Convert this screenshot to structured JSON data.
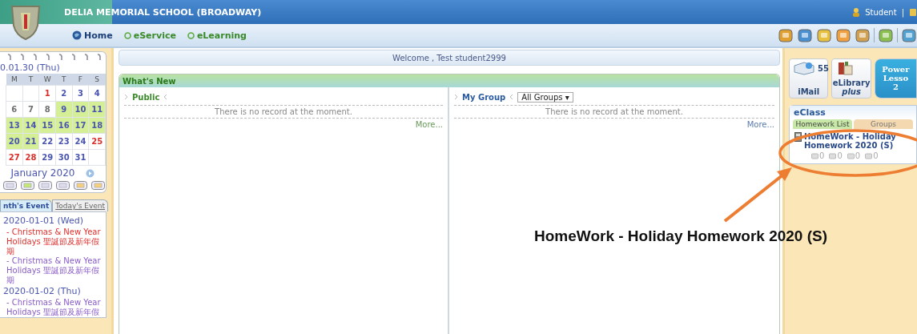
{
  "header": {
    "school_name": "DELIA MEMORIAL SCHOOL (BROADWAY)",
    "user_label": "Student",
    "separator": "|"
  },
  "nav": [
    {
      "label": "Home",
      "selected": true
    },
    {
      "label": "eService",
      "selected": false
    },
    {
      "label": "eLearning",
      "selected": false
    }
  ],
  "welcome": "Welcome , Test student2999",
  "calendar": {
    "date_heading": "0.01.30 (Thu)",
    "weekdays": [
      "M",
      "T",
      "W",
      "T",
      "F",
      "S"
    ],
    "weeks": [
      {
        "blanks_first": true,
        "days": [
          {
            "day": "1",
            "color": "#d9302c",
            "holiday": false
          },
          {
            "day": "2",
            "color": "#4a55b0",
            "holiday": false
          },
          {
            "day": "3",
            "color": "#4a55b0",
            "holiday": false
          },
          {
            "day": "4",
            "color": "#4a55b0",
            "holiday": false
          }
        ]
      },
      {
        "blanks_first": false,
        "days": [
          {
            "day": "6",
            "color": "#707070",
            "holiday": false
          },
          {
            "day": "7",
            "color": "#707070",
            "holiday": false
          },
          {
            "day": "8",
            "color": "#707070",
            "holiday": false
          },
          {
            "day": "9",
            "color": "#4a55b0",
            "holiday": true
          },
          {
            "day": "10",
            "color": "#4a55b0",
            "holiday": true
          },
          {
            "day": "11",
            "color": "#4a55b0",
            "holiday": true
          }
        ]
      },
      {
        "blanks_first": false,
        "days": [
          {
            "day": "13",
            "color": "#4a55b0",
            "holiday": true
          },
          {
            "day": "14",
            "color": "#4a55b0",
            "holiday": true
          },
          {
            "day": "15",
            "color": "#4a55b0",
            "holiday": true
          },
          {
            "day": "16",
            "color": "#4a55b0",
            "holiday": true
          },
          {
            "day": "17",
            "color": "#4a55b0",
            "holiday": true
          },
          {
            "day": "18",
            "color": "#4a55b0",
            "holiday": true
          }
        ]
      },
      {
        "blanks_first": false,
        "days": [
          {
            "day": "20",
            "color": "#4a55b0",
            "holiday": true
          },
          {
            "day": "21",
            "color": "#4a55b0",
            "holiday": true
          },
          {
            "day": "22",
            "color": "#4a55b0",
            "holiday": false
          },
          {
            "day": "23",
            "color": "#4a55b0",
            "holiday": false
          },
          {
            "day": "24",
            "color": "#4a55b0",
            "holiday": false
          },
          {
            "day": "25",
            "color": "#d9302c",
            "holiday": false
          }
        ]
      },
      {
        "blanks_first": false,
        "days": [
          {
            "day": "27",
            "color": "#d9302c",
            "holiday": false
          },
          {
            "day": "28",
            "color": "#d9302c",
            "holiday": false
          },
          {
            "day": "29",
            "color": "#4a55b0",
            "holiday": false
          },
          {
            "day": "30",
            "color": "#4a55b0",
            "holiday": false
          },
          {
            "day": "31",
            "color": "#4a55b0",
            "holiday": false
          }
        ]
      }
    ],
    "month_label": "January 2020"
  },
  "event_tabs": [
    {
      "label": "nth's Event",
      "selected": true
    },
    {
      "label": "Today's Event",
      "selected": false
    }
  ],
  "events": [
    {
      "date": "2020-01-01 (Wed)",
      "items": [
        {
          "text": "- Christmas & New Year Holidays 聖誕節及新年假期",
          "color": "#e0302c"
        },
        {
          "text": "- Christmas & New Year Holidays 聖誕節及新年假期",
          "color": "#8a5cc8"
        }
      ]
    },
    {
      "date": "2020-01-02 (Thu)",
      "items": [
        {
          "text": "- Christmas & New Year Holidays 聖誕節及新年假",
          "color": "#8a5cc8"
        }
      ]
    }
  ],
  "news": {
    "title": "What's New",
    "sections": [
      {
        "kind": "public",
        "title": "Public",
        "empty_text": "There is no record at the moment.",
        "more": "More..."
      },
      {
        "kind": "group",
        "title": "My Group",
        "filter": "All Groups ▾",
        "empty_text": "There is no record at the moment.",
        "more": "More..."
      }
    ]
  },
  "apps": [
    {
      "kind": "mail",
      "label": "iMail",
      "count": "55"
    },
    {
      "kind": "library",
      "label": "eLibrary",
      "sublabel": "plus"
    },
    {
      "kind": "lesson",
      "label": "Power Lesso",
      "sublabel": "2"
    }
  ],
  "eclass": {
    "title": "eClass",
    "tabs": [
      {
        "label": "Homework List",
        "selected": true
      },
      {
        "label": "Groups",
        "selected": false
      }
    ],
    "items": [
      {
        "title": "HomeWork - Holiday Homework 2020 (S)",
        "counts": [
          "0",
          "0",
          "0",
          "0"
        ]
      }
    ]
  },
  "annotation": {
    "text": "HomeWork - Holiday Homework 2020 (S)"
  }
}
